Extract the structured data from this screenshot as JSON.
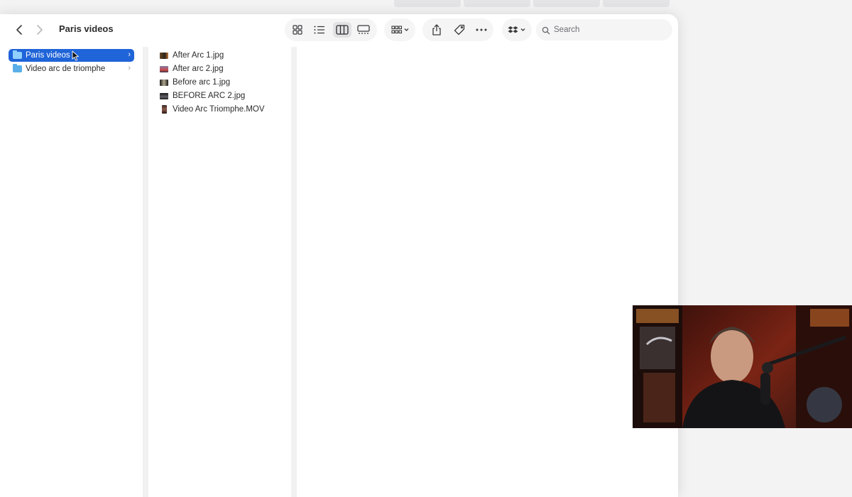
{
  "window": {
    "title": "Paris videos"
  },
  "toolbar": {
    "back_icon": "chevron-left-icon",
    "forward_icon": "chevron-right-icon",
    "view_icons": [
      "icon-view-icon",
      "list-view-icon",
      "column-view-icon",
      "gallery-view-icon"
    ],
    "active_view": "column-view-icon",
    "group_icon": "group-by-icon",
    "share_icon": "share-icon",
    "tag_icon": "tag-icon",
    "more_icon": "more-icon",
    "dropbox_icon": "dropbox-icon",
    "search_placeholder": "Search"
  },
  "column1": {
    "items": [
      {
        "label": "Paris videos",
        "selected": true
      },
      {
        "label": "Video arc de triomphe",
        "selected": false
      }
    ]
  },
  "column2": {
    "items": [
      {
        "label": "After Arc 1.jpg",
        "kind": "image"
      },
      {
        "label": "After arc 2.jpg",
        "kind": "image"
      },
      {
        "label": "Before arc 1.jpg",
        "kind": "image"
      },
      {
        "label": "BEFORE ARC 2.jpg",
        "kind": "image"
      },
      {
        "label": "Video Arc Triomphe.MOV",
        "kind": "video"
      }
    ]
  },
  "colors": {
    "selection": "#1f64d8",
    "folder": "#5aaee9"
  }
}
